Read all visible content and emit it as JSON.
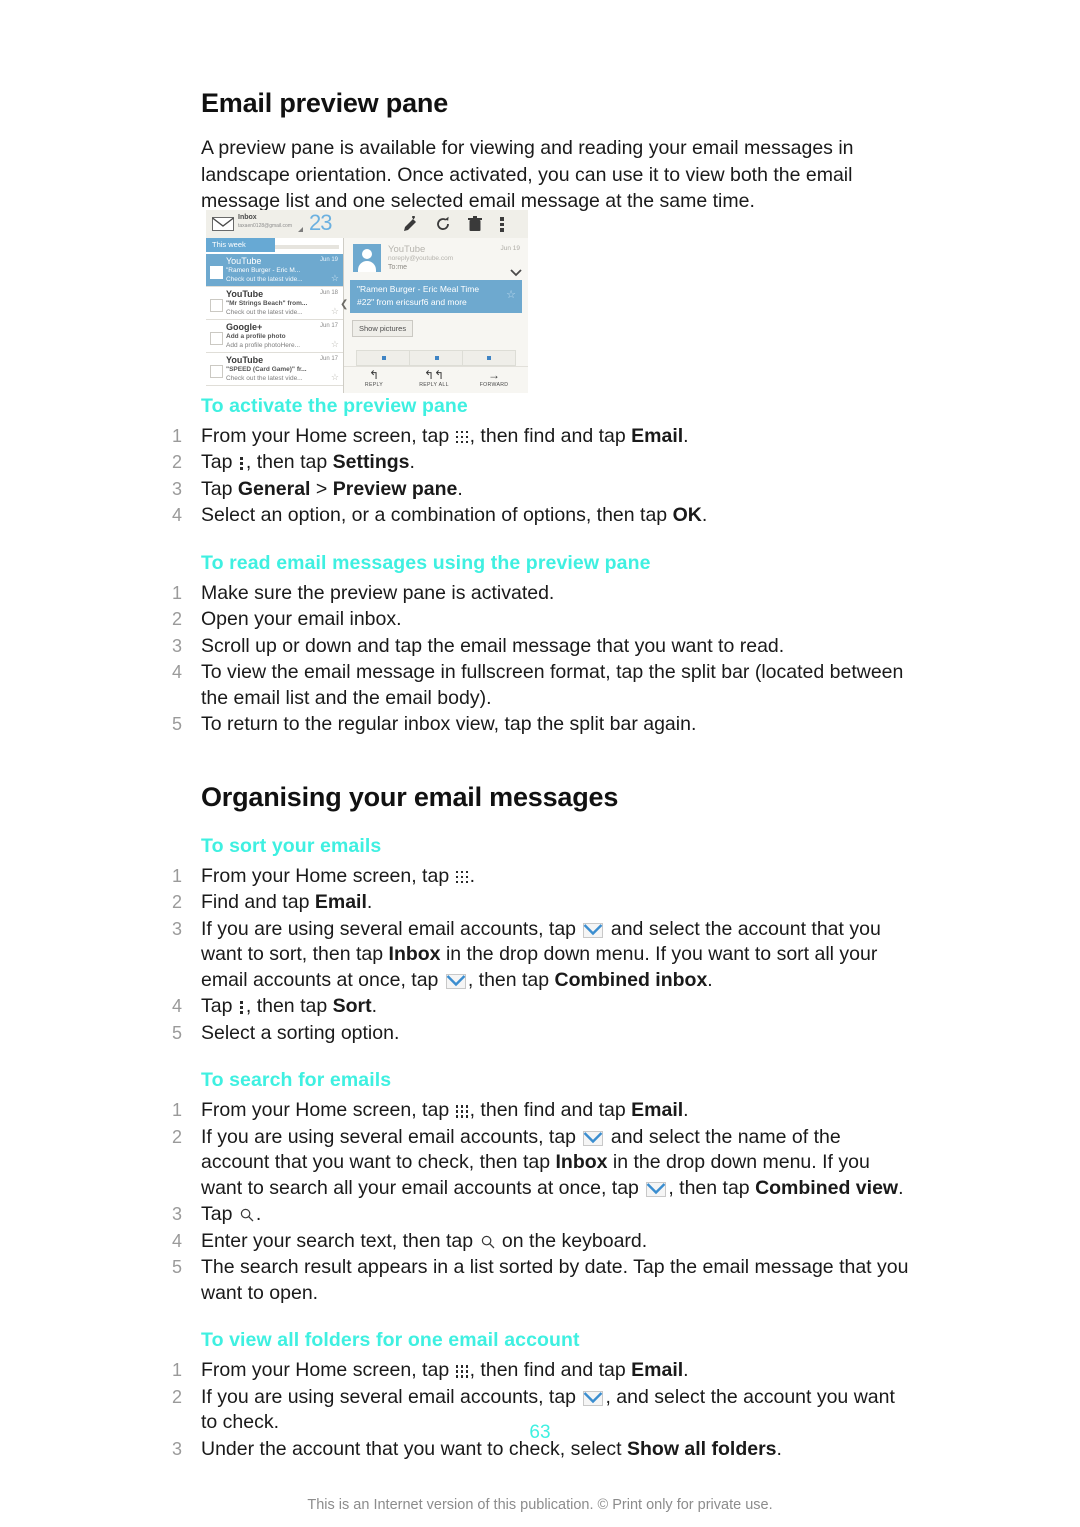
{
  "document": {
    "page_number": "63",
    "footer": "This is an Internet version of this publication. © Print only for private use."
  },
  "sections": [
    {
      "heading": "Email preview pane",
      "intro": "A preview pane is available for viewing and reading your email messages in landscape orientation. Once activated, you can use it to view both the email message list and one selected email message at the same time."
    },
    {
      "heading": "Organising your email messages"
    }
  ],
  "procedures": {
    "activate_preview_pane": {
      "title": "To activate the preview pane",
      "steps": [
        {
          "num": "1",
          "parts": [
            {
              "t": "text",
              "v": "From your Home screen, tap "
            },
            {
              "t": "icon",
              "v": "app-grid-icon"
            },
            {
              "t": "text",
              "v": ", then find and tap "
            },
            {
              "t": "bold",
              "v": "Email"
            },
            {
              "t": "text",
              "v": "."
            }
          ]
        },
        {
          "num": "2",
          "parts": [
            {
              "t": "text",
              "v": "Tap "
            },
            {
              "t": "icon",
              "v": "overflow-menu-icon"
            },
            {
              "t": "text",
              "v": ", then tap "
            },
            {
              "t": "bold",
              "v": "Settings"
            },
            {
              "t": "text",
              "v": "."
            }
          ]
        },
        {
          "num": "3",
          "parts": [
            {
              "t": "text",
              "v": "Tap "
            },
            {
              "t": "bold",
              "v": "General"
            },
            {
              "t": "text",
              "v": " > "
            },
            {
              "t": "bold",
              "v": "Preview pane"
            },
            {
              "t": "text",
              "v": "."
            }
          ]
        },
        {
          "num": "4",
          "parts": [
            {
              "t": "text",
              "v": "Select an option, or a combination of options, then tap "
            },
            {
              "t": "bold",
              "v": "OK"
            },
            {
              "t": "text",
              "v": "."
            }
          ]
        }
      ]
    },
    "read_using_preview_pane": {
      "title": "To read email messages using the preview pane",
      "steps": [
        {
          "num": "1",
          "parts": [
            {
              "t": "text",
              "v": "Make sure the preview pane is activated."
            }
          ]
        },
        {
          "num": "2",
          "parts": [
            {
              "t": "text",
              "v": "Open your email inbox."
            }
          ]
        },
        {
          "num": "3",
          "parts": [
            {
              "t": "text",
              "v": "Scroll up or down and tap the email message that you want to read."
            }
          ]
        },
        {
          "num": "4",
          "parts": [
            {
              "t": "text",
              "v": "To view the email message in fullscreen format, tap the split bar (located between the email list and the email body)."
            }
          ]
        },
        {
          "num": "5",
          "parts": [
            {
              "t": "text",
              "v": "To return to the regular inbox view, tap the split bar again."
            }
          ]
        }
      ]
    },
    "sort_emails": {
      "title": "To sort your emails",
      "steps": [
        {
          "num": "1",
          "parts": [
            {
              "t": "text",
              "v": "From your Home screen, tap "
            },
            {
              "t": "icon",
              "v": "app-grid-icon"
            },
            {
              "t": "text",
              "v": "."
            }
          ]
        },
        {
          "num": "2",
          "parts": [
            {
              "t": "text",
              "v": "Find and tap "
            },
            {
              "t": "bold",
              "v": "Email"
            },
            {
              "t": "text",
              "v": "."
            }
          ]
        },
        {
          "num": "3",
          "parts": [
            {
              "t": "text",
              "v": "If you are using several email accounts, tap "
            },
            {
              "t": "icon",
              "v": "account-picker-envelope-icon"
            },
            {
              "t": "text",
              "v": " and select the account that you want to sort, then tap "
            },
            {
              "t": "bold",
              "v": "Inbox"
            },
            {
              "t": "text",
              "v": " in the drop down menu. If you want to sort all your email accounts at once, tap "
            },
            {
              "t": "icon",
              "v": "account-picker-envelope-icon"
            },
            {
              "t": "text",
              "v": ", then tap "
            },
            {
              "t": "bold",
              "v": "Combined inbox"
            },
            {
              "t": "text",
              "v": "."
            }
          ]
        },
        {
          "num": "4",
          "parts": [
            {
              "t": "text",
              "v": "Tap "
            },
            {
              "t": "icon",
              "v": "overflow-menu-icon"
            },
            {
              "t": "text",
              "v": ", then tap "
            },
            {
              "t": "bold",
              "v": "Sort"
            },
            {
              "t": "text",
              "v": "."
            }
          ]
        },
        {
          "num": "5",
          "parts": [
            {
              "t": "text",
              "v": "Select a sorting option."
            }
          ]
        }
      ]
    },
    "search_emails": {
      "title": "To search for emails",
      "steps": [
        {
          "num": "1",
          "parts": [
            {
              "t": "text",
              "v": "From your Home screen, tap "
            },
            {
              "t": "icon",
              "v": "app-grid-icon"
            },
            {
              "t": "text",
              "v": ", then find and tap "
            },
            {
              "t": "bold",
              "v": "Email"
            },
            {
              "t": "text",
              "v": "."
            }
          ]
        },
        {
          "num": "2",
          "parts": [
            {
              "t": "text",
              "v": "If you are using several email accounts, tap "
            },
            {
              "t": "icon",
              "v": "account-picker-envelope-icon"
            },
            {
              "t": "text",
              "v": " and select the name of the account that you want to check, then tap "
            },
            {
              "t": "bold",
              "v": "Inbox"
            },
            {
              "t": "text",
              "v": " in the drop down menu. If you want to search all your email accounts at once, tap "
            },
            {
              "t": "icon",
              "v": "account-picker-envelope-icon"
            },
            {
              "t": "text",
              "v": ", then tap "
            },
            {
              "t": "bold",
              "v": "Combined view"
            },
            {
              "t": "text",
              "v": "."
            }
          ]
        },
        {
          "num": "3",
          "parts": [
            {
              "t": "text",
              "v": "Tap "
            },
            {
              "t": "icon",
              "v": "search-icon"
            },
            {
              "t": "text",
              "v": "."
            }
          ]
        },
        {
          "num": "4",
          "parts": [
            {
              "t": "text",
              "v": "Enter your search text, then tap "
            },
            {
              "t": "icon",
              "v": "search-icon"
            },
            {
              "t": "text",
              "v": " on the keyboard."
            }
          ]
        },
        {
          "num": "5",
          "parts": [
            {
              "t": "text",
              "v": "The search result appears in a list sorted by date. Tap the email message that you want to open."
            }
          ]
        }
      ]
    },
    "view_all_folders": {
      "title": "To view all folders for one email account",
      "steps": [
        {
          "num": "1",
          "parts": [
            {
              "t": "text",
              "v": "From your Home screen, tap "
            },
            {
              "t": "icon",
              "v": "app-grid-icon"
            },
            {
              "t": "text",
              "v": ", then find and tap "
            },
            {
              "t": "bold",
              "v": "Email"
            },
            {
              "t": "text",
              "v": "."
            }
          ]
        },
        {
          "num": "2",
          "parts": [
            {
              "t": "text",
              "v": "If you are using several email accounts, tap "
            },
            {
              "t": "icon",
              "v": "account-picker-envelope-icon"
            },
            {
              "t": "text",
              "v": ", and select the account you want to check."
            }
          ]
        },
        {
          "num": "3",
          "parts": [
            {
              "t": "text",
              "v": "Under the account that you want to check, select "
            },
            {
              "t": "bold",
              "v": "Show all folders"
            },
            {
              "t": "text",
              "v": "."
            }
          ]
        }
      ]
    }
  },
  "figure": {
    "name": "email-preview-pane-screenshot",
    "topbar": {
      "title": "Inbox",
      "account": "taxaen0128@gmail.com",
      "count": "23",
      "icons": [
        "compose-icon",
        "refresh-icon",
        "trash-icon",
        "overflow-menu-icon"
      ]
    },
    "message_list": {
      "group_label": "This week",
      "rows": [
        {
          "sender": "YouTube",
          "date": "Jun 19",
          "subject": "\"Ramen Burger - Eric M...",
          "snippet": "Check out the latest vide...",
          "selected": true
        },
        {
          "sender": "YouTube",
          "date": "Jun 18",
          "subject": "\"Mr Strings Beach\" from...",
          "snippet": "Check out the latest vide...",
          "selected": false
        },
        {
          "sender": "Google+",
          "date": "Jun 17",
          "subject": "Add a profile photo",
          "snippet": "Add a profile photoHere...",
          "selected": false
        },
        {
          "sender": "YouTube",
          "date": "Jun 17",
          "subject": "\"SPEED (Card Game)\" fr...",
          "snippet": "Check out the latest vide...",
          "selected": false
        }
      ]
    },
    "reading_pane": {
      "from_name": "YouTube",
      "from_address": "noreply@youtube.com",
      "to": "To:me",
      "date": "Jun 19",
      "subject_line1": "\"Ramen Burger - Eric Meal Time",
      "subject_line2": "#22\" from ericsurf6 and more",
      "show_pictures_label": "Show pictures",
      "actions": [
        {
          "label": "REPLY",
          "glyph": "↰"
        },
        {
          "label": "REPLY ALL",
          "glyph": "↰↰"
        },
        {
          "label": "FORWARD",
          "glyph": "→"
        }
      ]
    }
  },
  "colors": {
    "heading_cyan": "#3FF0E1",
    "body_text": "#1a1a1a",
    "step_number": "#9a9a9a",
    "phone_blue": "#6ea9cf",
    "footer_gray": "#8c8c8c"
  }
}
